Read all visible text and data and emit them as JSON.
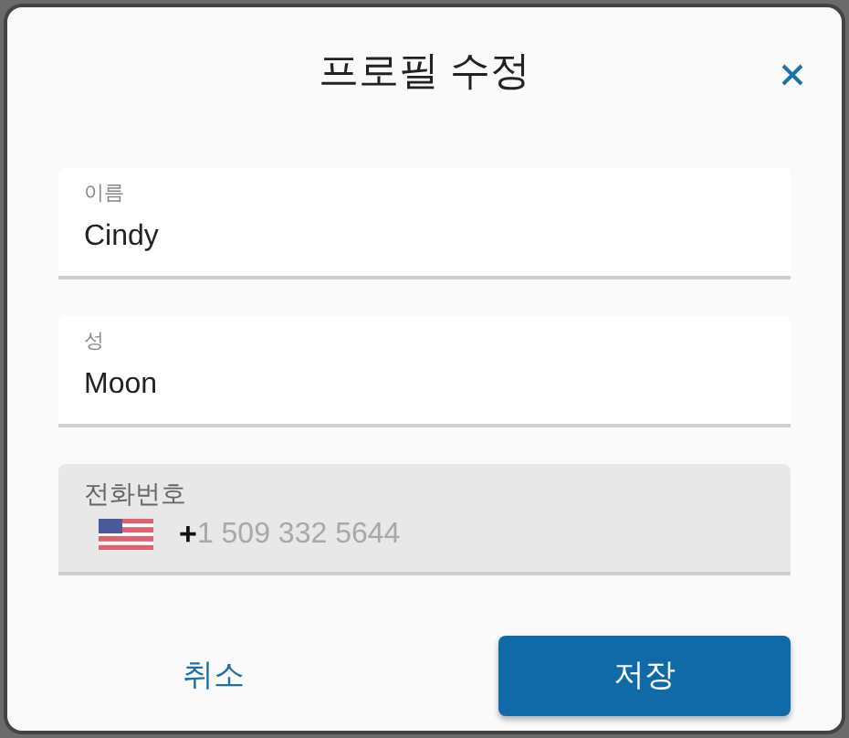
{
  "dialog": {
    "title": "프로필 수정"
  },
  "fields": [
    {
      "kind": "text",
      "label": "이름",
      "value": "Cindy",
      "disabled": false
    },
    {
      "kind": "text",
      "label": "성",
      "value": "Moon",
      "disabled": false
    },
    {
      "kind": "phone",
      "label": "전화번호",
      "prefix": "+",
      "placeholder": "1 509 332 5644",
      "disabled": true
    }
  ],
  "buttons": [
    {
      "kind": "text",
      "label": "취소"
    },
    {
      "kind": "primary",
      "label": "저장"
    }
  ]
}
